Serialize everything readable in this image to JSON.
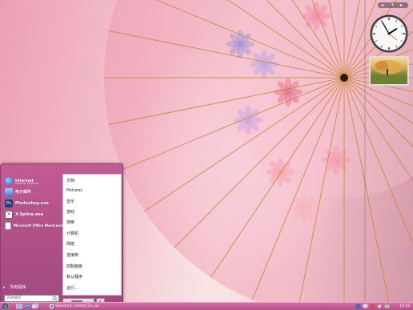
{
  "desktop": {
    "wallpaper": "pink-paper-umbrella-wallpaper"
  },
  "gadgets": {
    "controls": [
      "minus",
      "plus",
      "close"
    ],
    "clock": {
      "hour": 1,
      "minute": 55
    },
    "slideshow": {
      "content": "autumn-tree-photo"
    }
  },
  "start_menu": {
    "pinned_programs": [
      {
        "name": "Internet",
        "sub": "Internet Explorer",
        "icon": "internet-explorer-icon",
        "color": "#3a7dd8"
      },
      {
        "name": "电子邮件",
        "sub": "",
        "icon": "mail-icon",
        "color": "#4a90d9"
      },
      {
        "name": "Photoshop.exe",
        "sub": "",
        "icon": "photoshop-icon",
        "color": "#1f3e7a"
      },
      {
        "name": "X-Spline.exe",
        "sub": "",
        "icon": "xspline-icon",
        "color": "#ffffff"
      },
      {
        "name": "Microsoft Office Word.exe",
        "sub": "",
        "icon": "word-icon",
        "color": "#f5f5f5"
      }
    ],
    "all_programs_label": "所有程序",
    "search_placeholder": "开始搜索",
    "right_items": [
      "文档",
      "Pictures",
      "音乐",
      "游戏",
      "搜索",
      "计算机",
      "网络",
      "连接到",
      "控制面板",
      "默认程序",
      "运行..."
    ]
  },
  "taskbar": {
    "task_label": "Standard_Control_Ex_pu",
    "clock": "12:16",
    "colors": {
      "bar": "#c25a94",
      "menu": "#b5538a"
    }
  }
}
